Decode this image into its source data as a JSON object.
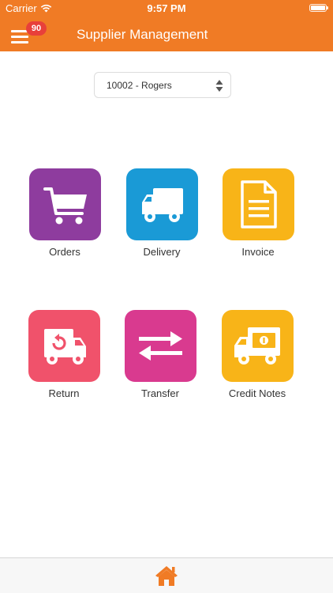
{
  "status_bar": {
    "carrier": "Carrier",
    "time": "9:57 PM"
  },
  "header": {
    "title": "Supplier Management",
    "badge_count": "90"
  },
  "supplier_select": {
    "value": "10002 - Rogers"
  },
  "tiles": [
    {
      "label": "Orders",
      "color": "#8e3c9e",
      "icon": "cart-icon"
    },
    {
      "label": "Delivery",
      "color": "#1a9ad6",
      "icon": "truck-icon"
    },
    {
      "label": "Invoice",
      "color": "#f8b418",
      "icon": "document-icon"
    },
    {
      "label": "Return",
      "color": "#f0526b",
      "icon": "return-truck-icon"
    },
    {
      "label": "Transfer",
      "color": "#d93a8f",
      "icon": "transfer-arrows-icon"
    },
    {
      "label": "Credit Notes",
      "color": "#f8b418",
      "icon": "money-truck-icon"
    }
  ],
  "tab_bar": {
    "home_icon": "home-icon",
    "accent": "#f07b25"
  },
  "colors": {
    "header": "#f07b25",
    "badge": "#e8403a"
  }
}
